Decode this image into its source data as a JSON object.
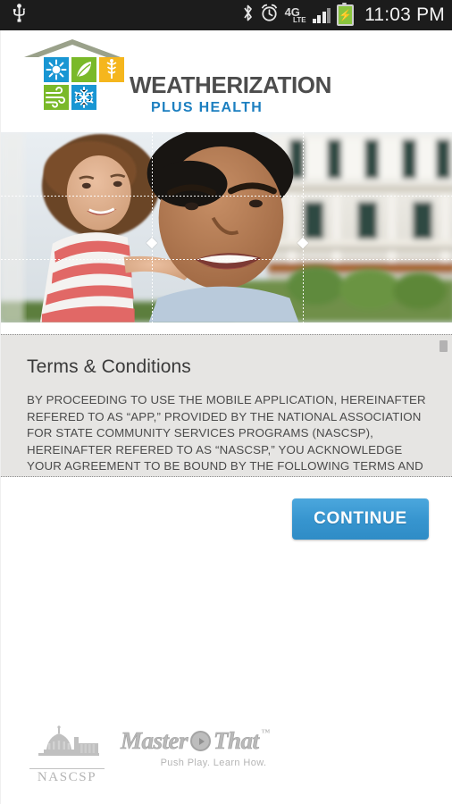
{
  "statusbar": {
    "icons": [
      "usb-icon",
      "bluetooth-icon",
      "alarm-clock-icon",
      "4g-lte-icon",
      "signal-bars-icon",
      "battery-charging-icon"
    ],
    "network_label": "4G",
    "network_sub": "LTE",
    "clock": "11:03 PM",
    "background": "#1c1c1c"
  },
  "header": {
    "logo": {
      "brand_main": "WEATHERIZATION",
      "brand_sub": "PLUS HEALTH",
      "roof_color": "#9aa18a",
      "tile_blue": "#1996d3",
      "tile_green": "#7ab929",
      "tile_gold": "#f5b61d",
      "brand_main_color": "#4d4d4d",
      "brand_sub_color": "#1c7fc0",
      "tiles": [
        {
          "name": "sun-icon",
          "color": "#1996d3"
        },
        {
          "name": "leaf-icon",
          "color": "#7ab929"
        },
        {
          "name": "caduceus-icon",
          "color": "#f5b61d"
        },
        {
          "name": "wind-icon",
          "color": "#7ab929"
        },
        {
          "name": "snowflake-icon",
          "color": "#1996d3"
        }
      ]
    }
  },
  "hero": {
    "alt": "Smiling man holding a young girl in front of a house",
    "crop_guides": true
  },
  "terms": {
    "title": "Terms & Conditions",
    "body": "BY PROCEEDING TO USE THE MOBILE APPLICATION, HEREINAFTER REFERED TO AS “APP,” PROVIDED BY THE NATIONAL ASSOCIATION FOR STATE COMMUNITY SERVICES PROGRAMS (NASCSP), HEREINAFTER REFERED TO AS “NASCSP,” YOU ACKNOWLEDGE YOUR AGREEMENT TO BE BOUND BY THE FOLLOWING TERMS AND CONDITIONS. IF YOU DO NOT AGREE WITH THESE TERMS AND",
    "background": "#e6e5e3"
  },
  "actions": {
    "continue_label": "CONTINUE",
    "continue_color": "#3795cf"
  },
  "footer": {
    "nascsp_label": "NASCSP",
    "masterthat_part1": "Master",
    "masterthat_part2": "That",
    "masterthat_tm": "™",
    "masterthat_tagline": "Push Play. Learn How."
  }
}
